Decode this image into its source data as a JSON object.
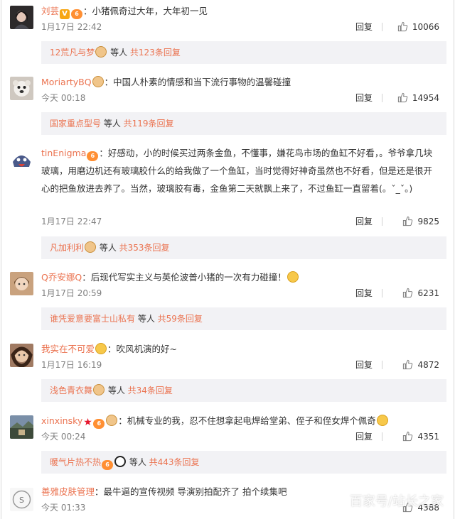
{
  "comments": [
    {
      "user": "刘芸",
      "text": "：小猪佩奇过大年，大年初一见",
      "time": "1月17日 22:42",
      "reply": "回复",
      "likes": "10066",
      "sub": {
        "who": "12荒凡与梦",
        "mid": " 等人 ",
        "more": "共123条回复"
      }
    },
    {
      "user": "MoriartyBQ",
      "text": "：中国人朴素的情感和当下流行事物的温馨碰撞",
      "time": "今天 00:18",
      "reply": "回复",
      "likes": "14954",
      "sub": {
        "who": "国家重点型号",
        "mid": " 等人 ",
        "more": "共119条回复"
      }
    },
    {
      "user": "tinEnigma",
      "text": "：好感动，小的时候买过两条金鱼，不懂事，嫌花鸟市场的鱼缸不好看，。爷爷拿几块玻璃，用磨边机还有玻璃胶什么的给我做了一个鱼缸，当时觉得好神奇虽然也不好看，但是还是很开心的把鱼放进去养了。当然，玻璃胶有毒，金鱼第二天就飘上来了，不过鱼缸一直留着(。ˇ_ˇ。)",
      "time": "1月17日 22:47",
      "reply": "回复",
      "likes": "9825",
      "sub": {
        "who": "凡加利利",
        "mid": " 等人 ",
        "more": "共353条回复"
      }
    },
    {
      "user": "Q乔安娜Q",
      "text": "：后现代写实主义与英伦波普小猪的一次有力碰撞！",
      "time": "1月17日 20:59",
      "reply": "回复",
      "likes": "6231",
      "sub": {
        "who": "谁凭爱意要富士山私有",
        "mid": " 等人 ",
        "more": "共59条回复"
      }
    },
    {
      "user": "我实在不可爱",
      "text": "：吹风机演的好~",
      "time": "1月17日 16:19",
      "reply": "回复",
      "likes": "4872",
      "sub": {
        "who": "浅色青衣舞",
        "mid": " 等人 ",
        "more": "共34条回复"
      }
    },
    {
      "user": "xinxinsky",
      "text": "：机械专业的我，忍不住想拿起电焊给堂弟、侄子和侄女焊个佩奇",
      "time": "今天 00:24",
      "reply": "回复",
      "likes": "4351",
      "sub": {
        "who": "暖气片热不热",
        "mid": " 等人 ",
        "more": "共443条回复"
      }
    },
    {
      "user": "善雅皮肤管理",
      "text": "：最牛逼的宣传视频 导演别拍配齐了 拍个续集吧",
      "time": "今天 01:33",
      "reply": "回复",
      "likes": "4388"
    }
  ],
  "badges": {
    "vip": "V",
    "level": "6"
  },
  "watermark": "百家号/站长之家",
  "colors": {
    "link": "#eb7350",
    "sub_bg": "#f2f2f5",
    "meta": "#808080"
  }
}
